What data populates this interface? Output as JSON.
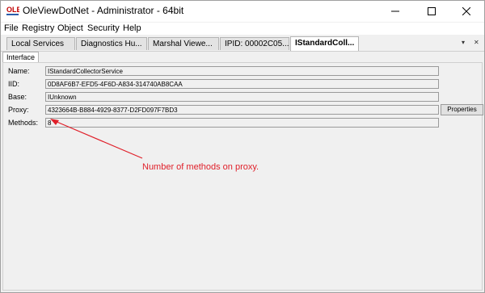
{
  "window": {
    "app_name": "OleViewDotNet",
    "title": "OleViewDotNet - Administrator - 64bit",
    "icon_text": "OLE"
  },
  "menu": {
    "items": [
      "File",
      "Registry",
      "Object",
      "Security",
      "Help"
    ]
  },
  "tabs": {
    "items": [
      "Local Services",
      "Diagnostics Hu...",
      "Marshal Viewe...",
      "IPID: 00002C05...",
      "IStandardColl..."
    ],
    "active_index": 4,
    "pin_glyph": "▾",
    "close_glyph": "✕"
  },
  "subtab": {
    "label": "Interface"
  },
  "fields": {
    "name_label": "Name:",
    "name_value": "IStandardCollectorService",
    "iid_label": "IID:",
    "iid_value": "0D8AF6B7-EFD5-4F6D-A834-314740AB8CAA",
    "base_label": "Base:",
    "base_value": "IUnknown",
    "proxy_label": "Proxy:",
    "proxy_value": "4323664B-B884-4929-8377-D2FD097F7BD3",
    "properties_button": "Properties",
    "methods_label": "Methods:",
    "methods_value": "8"
  },
  "annotation": {
    "text": "Number of methods on proxy.",
    "color": "#e0202a"
  },
  "titlebar_buttons": [
    "minimize-icon",
    "maximize-icon",
    "close-icon"
  ]
}
